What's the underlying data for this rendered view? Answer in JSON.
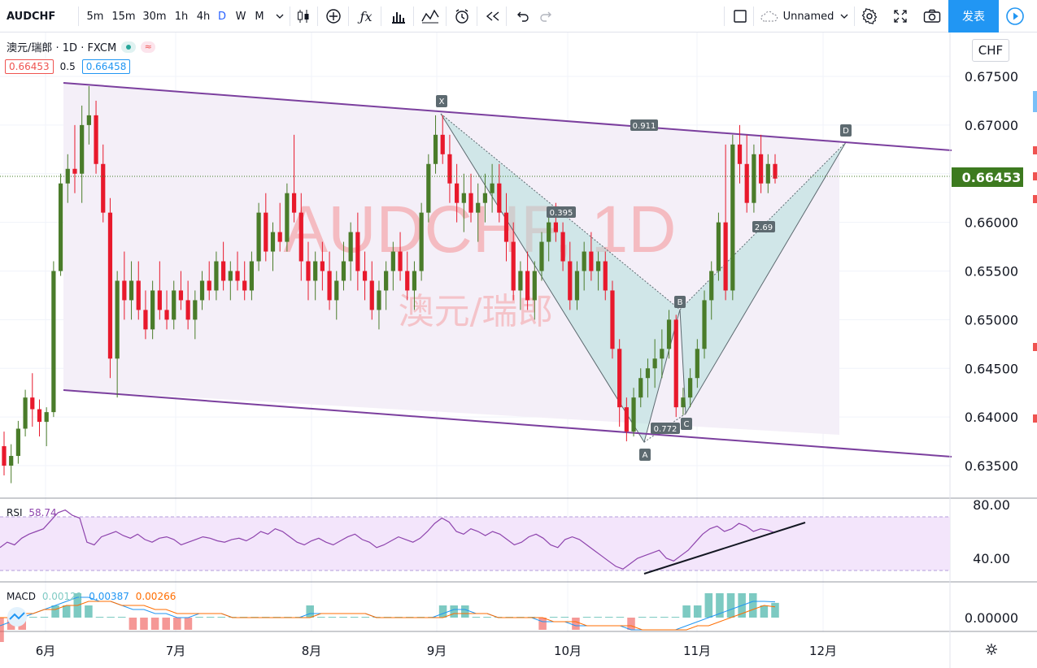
{
  "toolbar": {
    "symbol": "AUDCHF",
    "timeframes": [
      "5m",
      "15m",
      "30m",
      "1h",
      "4h",
      "D",
      "W",
      "M"
    ],
    "active_timeframe": "D",
    "layout_name": "Unnamed",
    "publish_label": "发表"
  },
  "legend": {
    "title": "澳元/瑞郎 · 1D · FXCM",
    "bid": "0.66453",
    "spread": "0.5",
    "ask": "0.66458",
    "bid_color": "#ef5350",
    "ask_color": "#2196f3"
  },
  "price_axis": {
    "currency": "CHF",
    "ticks": [
      "0.67500",
      "0.67000",
      "0.66500",
      "0.66000",
      "0.65500",
      "0.65000",
      "0.64500",
      "0.64000",
      "0.63500"
    ],
    "last_price": "0.66453",
    "last_price_color": "#3d7a1f"
  },
  "time_axis": {
    "labels": [
      "6月",
      "7月",
      "8月",
      "9月",
      "10月",
      "11月",
      "12月"
    ]
  },
  "watermark": {
    "main": "AUDCHF, 1D",
    "sub": "澳元/瑞郎"
  },
  "harmonic": {
    "points": [
      "X",
      "A",
      "B",
      "C",
      "D"
    ],
    "ratios": [
      "0.911",
      "0.395",
      "0.772",
      "2.69"
    ]
  },
  "rsi": {
    "label": "RSI",
    "value": "58.74",
    "ticks": [
      "80.00",
      "40.00"
    ]
  },
  "macd": {
    "label": "MACD",
    "v1": "0.00121",
    "v2": "0.00387",
    "v3": "0.00266",
    "ticks": [
      "0.00000"
    ]
  },
  "colors": {
    "up": "#4a7c2a",
    "down": "#e8192c",
    "channel": "#7b3f9e",
    "pattern_fill": "#b2dfdb",
    "watermark": "#f4a6aa"
  },
  "chart_data": {
    "type": "candlestick",
    "ylim": [
      0.632,
      0.6783
    ],
    "series": [
      {
        "name": "AUDCHF",
        "values": [
          [
            0.637,
            0.6385,
            0.634,
            0.635
          ],
          [
            0.635,
            0.6372,
            0.6332,
            0.636
          ],
          [
            0.636,
            0.6396,
            0.6352,
            0.6388
          ],
          [
            0.6388,
            0.6428,
            0.638,
            0.642
          ],
          [
            0.642,
            0.6445,
            0.639,
            0.6408
          ],
          [
            0.6408,
            0.6418,
            0.638,
            0.6395
          ],
          [
            0.6395,
            0.641,
            0.637,
            0.6405
          ],
          [
            0.6405,
            0.656,
            0.64,
            0.655
          ],
          [
            0.655,
            0.665,
            0.6545,
            0.664
          ],
          [
            0.664,
            0.667,
            0.662,
            0.6655
          ],
          [
            0.6655,
            0.67,
            0.663,
            0.665
          ],
          [
            0.665,
            0.672,
            0.662,
            0.67
          ],
          [
            0.67,
            0.674,
            0.668,
            0.671
          ],
          [
            0.671,
            0.6725,
            0.665,
            0.666
          ],
          [
            0.666,
            0.668,
            0.66,
            0.661
          ],
          [
            0.661,
            0.6625,
            0.644,
            0.646
          ],
          [
            0.646,
            0.655,
            0.642,
            0.654
          ],
          [
            0.654,
            0.657,
            0.65,
            0.652
          ],
          [
            0.652,
            0.656,
            0.65,
            0.654
          ],
          [
            0.654,
            0.656,
            0.65,
            0.651
          ],
          [
            0.651,
            0.653,
            0.648,
            0.649
          ],
          [
            0.649,
            0.654,
            0.648,
            0.653
          ],
          [
            0.653,
            0.656,
            0.65,
            0.651
          ],
          [
            0.651,
            0.653,
            0.649,
            0.65
          ],
          [
            0.65,
            0.654,
            0.649,
            0.653
          ],
          [
            0.653,
            0.655,
            0.651,
            0.652
          ],
          [
            0.652,
            0.654,
            0.649,
            0.65
          ],
          [
            0.65,
            0.653,
            0.648,
            0.652
          ],
          [
            0.652,
            0.655,
            0.651,
            0.654
          ],
          [
            0.654,
            0.656,
            0.652,
            0.653
          ],
          [
            0.653,
            0.657,
            0.652,
            0.656
          ],
          [
            0.656,
            0.658,
            0.653,
            0.654
          ],
          [
            0.654,
            0.656,
            0.652,
            0.655
          ],
          [
            0.655,
            0.657,
            0.653,
            0.654
          ],
          [
            0.654,
            0.656,
            0.652,
            0.653
          ],
          [
            0.653,
            0.657,
            0.652,
            0.656
          ],
          [
            0.656,
            0.662,
            0.655,
            0.661
          ],
          [
            0.661,
            0.663,
            0.656,
            0.657
          ],
          [
            0.657,
            0.66,
            0.655,
            0.659
          ],
          [
            0.659,
            0.662,
            0.657,
            0.658
          ],
          [
            0.658,
            0.664,
            0.657,
            0.663
          ],
          [
            0.663,
            0.669,
            0.66,
            0.661
          ],
          [
            0.661,
            0.663,
            0.654,
            0.656
          ],
          [
            0.656,
            0.658,
            0.652,
            0.654
          ],
          [
            0.654,
            0.657,
            0.652,
            0.656
          ],
          [
            0.656,
            0.658,
            0.653,
            0.655
          ],
          [
            0.655,
            0.657,
            0.651,
            0.652
          ],
          [
            0.652,
            0.655,
            0.65,
            0.654
          ],
          [
            0.654,
            0.658,
            0.653,
            0.656
          ],
          [
            0.656,
            0.66,
            0.654,
            0.659
          ],
          [
            0.659,
            0.661,
            0.653,
            0.655
          ],
          [
            0.655,
            0.657,
            0.652,
            0.654
          ],
          [
            0.654,
            0.656,
            0.65,
            0.651
          ],
          [
            0.651,
            0.654,
            0.649,
            0.653
          ],
          [
            0.653,
            0.656,
            0.651,
            0.655
          ],
          [
            0.655,
            0.658,
            0.653,
            0.657
          ],
          [
            0.657,
            0.659,
            0.654,
            0.655
          ],
          [
            0.655,
            0.657,
            0.652,
            0.653
          ],
          [
            0.653,
            0.656,
            0.651,
            0.655
          ],
          [
            0.655,
            0.662,
            0.654,
            0.661
          ],
          [
            0.661,
            0.667,
            0.66,
            0.666
          ],
          [
            0.666,
            0.671,
            0.665,
            0.669
          ],
          [
            0.669,
            0.671,
            0.666,
            0.667
          ],
          [
            0.667,
            0.669,
            0.662,
            0.664
          ],
          [
            0.664,
            0.666,
            0.66,
            0.662
          ],
          [
            0.662,
            0.665,
            0.659,
            0.663
          ],
          [
            0.663,
            0.665,
            0.66,
            0.661
          ],
          [
            0.661,
            0.664,
            0.658,
            0.662
          ],
          [
            0.662,
            0.665,
            0.66,
            0.663
          ],
          [
            0.663,
            0.666,
            0.661,
            0.664
          ],
          [
            0.664,
            0.666,
            0.66,
            0.661
          ],
          [
            0.661,
            0.663,
            0.656,
            0.658
          ],
          [
            0.658,
            0.66,
            0.652,
            0.653
          ],
          [
            0.653,
            0.656,
            0.651,
            0.655
          ],
          [
            0.655,
            0.657,
            0.651,
            0.652
          ],
          [
            0.652,
            0.656,
            0.65,
            0.655
          ],
          [
            0.655,
            0.659,
            0.654,
            0.658
          ],
          [
            0.658,
            0.661,
            0.656,
            0.66
          ],
          [
            0.66,
            0.662,
            0.658,
            0.659
          ],
          [
            0.659,
            0.66,
            0.655,
            0.656
          ],
          [
            0.656,
            0.658,
            0.651,
            0.652
          ],
          [
            0.652,
            0.656,
            0.651,
            0.655
          ],
          [
            0.655,
            0.658,
            0.653,
            0.657
          ],
          [
            0.657,
            0.659,
            0.654,
            0.655
          ],
          [
            0.655,
            0.657,
            0.653,
            0.656
          ],
          [
            0.656,
            0.657,
            0.652,
            0.653
          ],
          [
            0.653,
            0.654,
            0.646,
            0.647
          ],
          [
            0.647,
            0.648,
            0.639,
            0.641
          ],
          [
            0.641,
            0.642,
            0.6375,
            0.6385
          ],
          [
            0.6385,
            0.643,
            0.638,
            0.642
          ],
          [
            0.642,
            0.645,
            0.641,
            0.644
          ],
          [
            0.644,
            0.646,
            0.642,
            0.645
          ],
          [
            0.645,
            0.648,
            0.643,
            0.646
          ],
          [
            0.646,
            0.649,
            0.644,
            0.647
          ],
          [
            0.647,
            0.651,
            0.646,
            0.65
          ],
          [
            0.65,
            0.6505,
            0.64,
            0.641
          ],
          [
            0.641,
            0.643,
            0.6402,
            0.642
          ],
          [
            0.642,
            0.645,
            0.641,
            0.644
          ],
          [
            0.644,
            0.648,
            0.643,
            0.647
          ],
          [
            0.647,
            0.653,
            0.646,
            0.652
          ],
          [
            0.652,
            0.656,
            0.65,
            0.655
          ],
          [
            0.655,
            0.661,
            0.654,
            0.66
          ],
          [
            0.66,
            0.668,
            0.652,
            0.653
          ],
          [
            0.653,
            0.669,
            0.652,
            0.668
          ],
          [
            0.668,
            0.67,
            0.664,
            0.666
          ],
          [
            0.666,
            0.669,
            0.661,
            0.662
          ],
          [
            0.662,
            0.668,
            0.661,
            0.667
          ],
          [
            0.667,
            0.669,
            0.663,
            0.664
          ],
          [
            0.664,
            0.667,
            0.663,
            0.666
          ],
          [
            0.666,
            0.667,
            0.664,
            0.6645
          ]
        ]
      },
      {
        "name": "RSI",
        "values": [
          48,
          52,
          50,
          55,
          58,
          60,
          62,
          68,
          74,
          76,
          72,
          70,
          52,
          50,
          56,
          58,
          60,
          57,
          55,
          58,
          54,
          52,
          55,
          56,
          54,
          50,
          52,
          54,
          56,
          55,
          53,
          52,
          54,
          55,
          53,
          56,
          60,
          58,
          62,
          60,
          56,
          52,
          50,
          53,
          55,
          52,
          50,
          53,
          56,
          58,
          54,
          52,
          48,
          50,
          53,
          56,
          54,
          52,
          55,
          60,
          66,
          70,
          67,
          60,
          58,
          62,
          60,
          57,
          60,
          58,
          54,
          50,
          52,
          56,
          58,
          55,
          50,
          48,
          54,
          56,
          54,
          50,
          46,
          42,
          38,
          34,
          32,
          36,
          40,
          42,
          44,
          46,
          40,
          38,
          42,
          46,
          52,
          58,
          62,
          64,
          60,
          62,
          66,
          64,
          60,
          62,
          61,
          59
        ]
      },
      {
        "name": "MACD",
        "values": [
          -0.002,
          -0.001,
          0.0,
          0.001,
          0.002,
          0.003,
          0.004,
          0.005,
          0.005,
          0.004,
          0.004,
          0.003,
          0.002,
          0.002,
          0.001,
          0.001,
          0.0,
          0.0,
          0.001,
          0.001,
          0.001,
          0.0,
          0.0,
          0.0,
          0.0,
          0.0,
          0.0,
          0.0,
          0.001,
          0.001,
          0.001,
          0.001,
          0.001,
          0.001,
          0.0,
          0.0,
          0.0,
          0.0,
          0.0,
          0.0,
          0.001,
          0.002,
          0.002,
          0.001,
          0.001,
          0.0,
          0.0,
          0.0,
          0.0,
          -0.001,
          -0.001,
          -0.001,
          -0.002,
          -0.002,
          -0.002,
          -0.002,
          -0.002,
          -0.003,
          -0.003,
          -0.003,
          -0.003,
          -0.003,
          -0.002,
          -0.001,
          0.0,
          0.001,
          0.002,
          0.003,
          0.004,
          0.004,
          0.00387
        ]
      },
      {
        "name": "Signal",
        "values": [
          0.0,
          0.0,
          0.001,
          0.001,
          0.002,
          0.002,
          0.003,
          0.003,
          0.004,
          0.004,
          0.004,
          0.003,
          0.003,
          0.003,
          0.002,
          0.002,
          0.001,
          0.001,
          0.001,
          0.001,
          0.001,
          0.0,
          0.0,
          0.0,
          0.0,
          0.0,
          0.0,
          0.0,
          0.0,
          0.001,
          0.001,
          0.001,
          0.001,
          0.001,
          0.0,
          0.0,
          0.0,
          0.0,
          0.0,
          0.0,
          0.0,
          0.001,
          0.001,
          0.001,
          0.001,
          0.0,
          0.0,
          0.0,
          0.0,
          0.0,
          -0.001,
          -0.001,
          -0.001,
          -0.002,
          -0.002,
          -0.002,
          -0.002,
          -0.002,
          -0.003,
          -0.003,
          -0.003,
          -0.003,
          -0.003,
          -0.002,
          -0.002,
          -0.001,
          0.0,
          0.001,
          0.002,
          0.003,
          0.00266
        ]
      }
    ]
  }
}
